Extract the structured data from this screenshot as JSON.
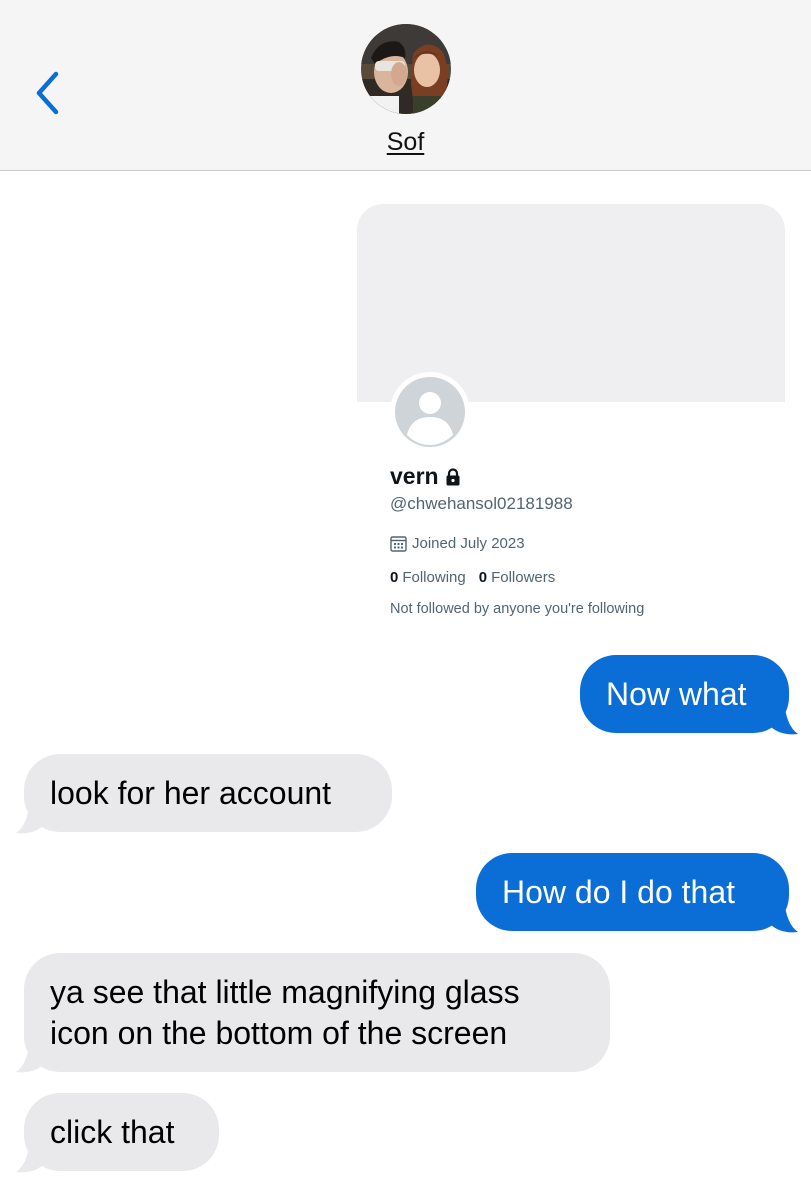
{
  "header": {
    "back_icon": "chevron-left-icon",
    "contact_name": "Sof",
    "accent_color": "#0b6dd6"
  },
  "profile_card": {
    "display_name": "vern",
    "handle": "@chwehansol02181988",
    "joined": "Joined July 2023",
    "following_count": "0",
    "following_label": "Following",
    "followers_count": "0",
    "followers_label": "Followers",
    "followed_by_note": "Not followed by anyone you're following"
  },
  "messages": [
    {
      "direction": "outgoing",
      "text": "Now what"
    },
    {
      "direction": "incoming",
      "text": "look for her account"
    },
    {
      "direction": "outgoing",
      "text": "How do I do that"
    },
    {
      "direction": "incoming",
      "lines": [
        "ya see that little magnifying glass",
        "icon on the bottom of the screen"
      ]
    },
    {
      "direction": "incoming",
      "text": "click that"
    }
  ],
  "colors": {
    "outgoing_bubble": "#0b6dd6",
    "incoming_bubble": "#e9e9ec",
    "header_bg": "#f5f5f5"
  }
}
